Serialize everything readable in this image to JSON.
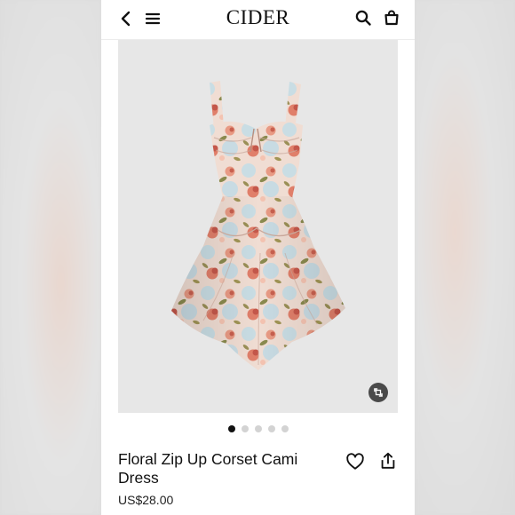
{
  "header": {
    "brand": "CIDER",
    "back_icon": "chevron-left-icon",
    "menu_icon": "hamburger-menu-icon",
    "search_icon": "search-icon",
    "cart_icon": "shopping-bag-icon"
  },
  "gallery": {
    "image_subject": "floral-cami-dress",
    "zoom_icon": "expand-icon",
    "slide_count": 5,
    "active_index": 0
  },
  "product": {
    "title": "Floral Zip Up Corset Cami Dress",
    "price": "US$28.00",
    "wishlist_icon": "heart-icon",
    "share_icon": "share-icon"
  },
  "colors": {
    "text": "#111111",
    "image_bg": "#e7e7e7",
    "dot_active": "#111111",
    "dot_inactive": "#d3d3d3"
  }
}
